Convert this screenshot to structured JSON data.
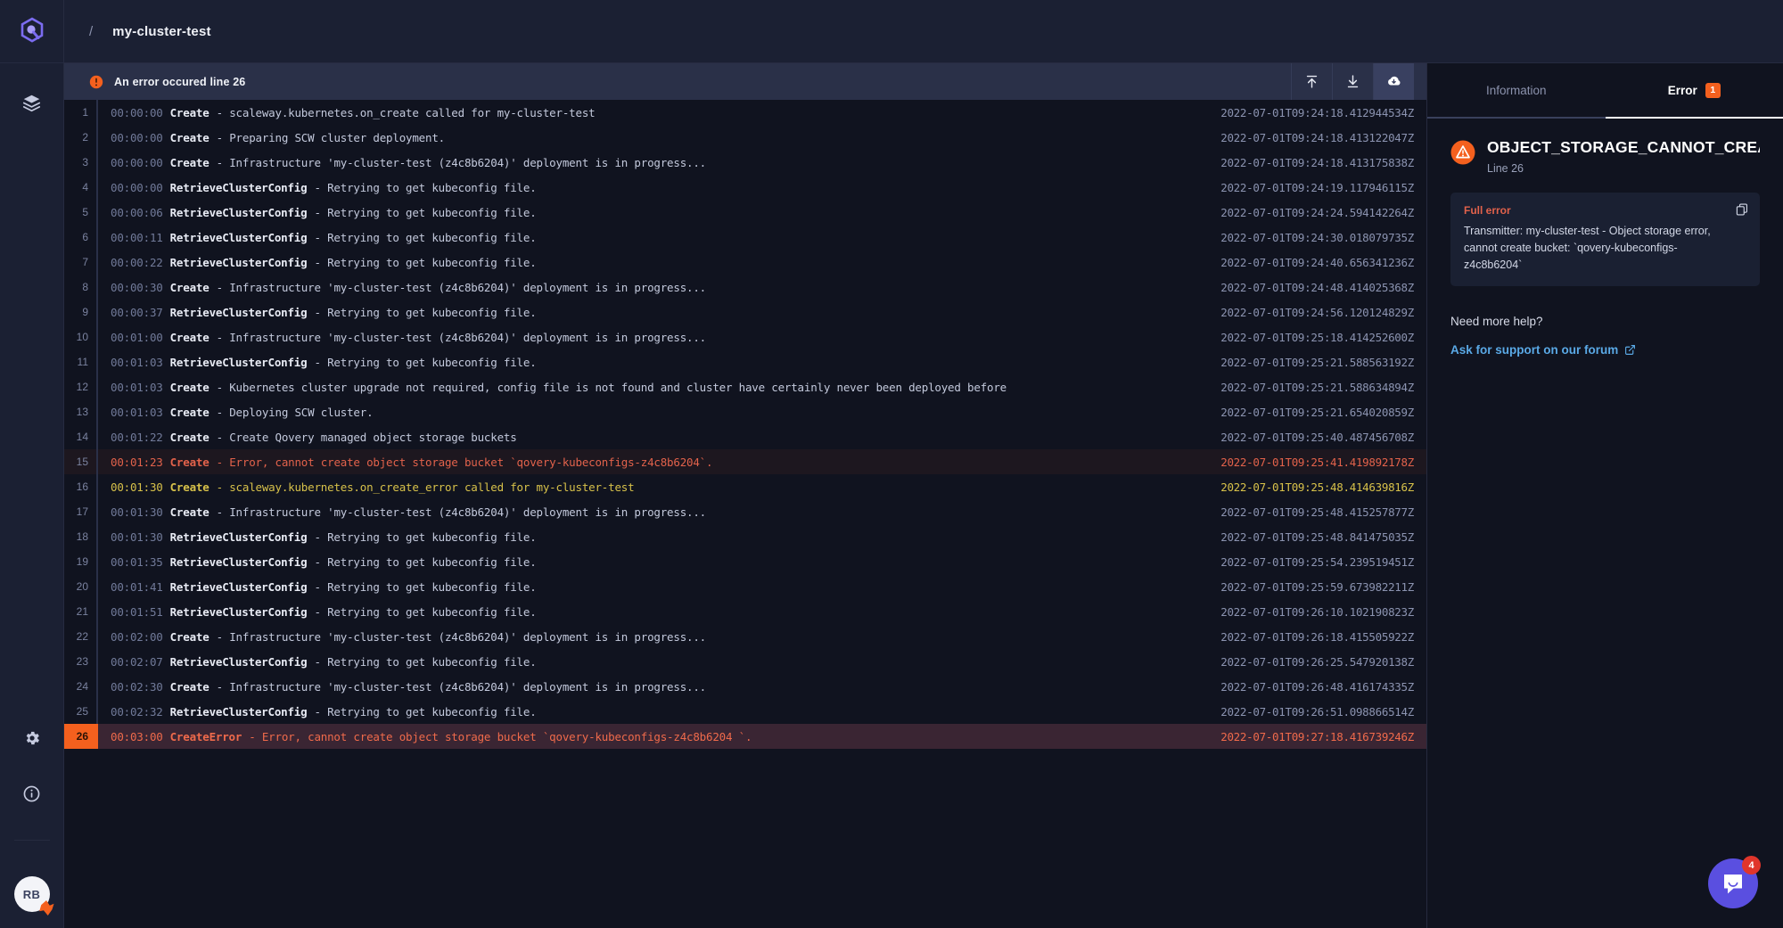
{
  "colors": {
    "accent_orange": "#f4601e",
    "error_red": "#e2624b",
    "warn_yellow": "#d7c14a",
    "link_blue": "#5aa9e6",
    "chat_purple": "#5a4fe0",
    "badge_red": "#e0352b",
    "panel_bg": "#10131f",
    "rail_bg": "#1b2033"
  },
  "rail": {
    "logo_icon": "qovery-hexagon-logo",
    "items": [
      {
        "icon": "layers-icon",
        "name": "sidebar-item-environments"
      }
    ],
    "bottom_items": [
      {
        "icon": "gear-icon",
        "name": "sidebar-item-settings"
      },
      {
        "icon": "info-icon",
        "name": "sidebar-item-info"
      }
    ],
    "avatar_initials": "RB"
  },
  "topbar": {
    "separator": "/",
    "cluster_name": "my-cluster-test"
  },
  "banner": {
    "icon": "error-circle-icon",
    "message": "An error occured line 26",
    "actions": [
      {
        "name": "scroll-to-top-button",
        "icon": "arrow-up-to-line-icon"
      },
      {
        "name": "download-logs-button",
        "icon": "arrow-down-to-line-icon"
      },
      {
        "name": "cloud-download-button",
        "icon": "cloud-download-icon"
      }
    ]
  },
  "logs": [
    {
      "n": "1",
      "time": "00:00:00",
      "step": "Create",
      "msg": "- scaleway.kubernetes.on_create called for my-cluster-test",
      "stamp": "2022-07-01T09:24:18.412944534Z",
      "level": "normal"
    },
    {
      "n": "2",
      "time": "00:00:00",
      "step": "Create",
      "msg": "- Preparing SCW cluster deployment.",
      "stamp": "2022-07-01T09:24:18.413122047Z",
      "level": "normal"
    },
    {
      "n": "3",
      "time": "00:00:00",
      "step": "Create",
      "msg": "- Infrastructure 'my-cluster-test (z4c8b6204)' deployment is in progress...",
      "stamp": "2022-07-01T09:24:18.413175838Z",
      "level": "normal"
    },
    {
      "n": "4",
      "time": "00:00:00",
      "step": "RetrieveClusterConfig",
      "msg": "- Retrying to get kubeconfig file.",
      "stamp": "2022-07-01T09:24:19.117946115Z",
      "level": "normal"
    },
    {
      "n": "5",
      "time": "00:00:06",
      "step": "RetrieveClusterConfig",
      "msg": "- Retrying to get kubeconfig file.",
      "stamp": "2022-07-01T09:24:24.594142264Z",
      "level": "normal"
    },
    {
      "n": "6",
      "time": "00:00:11",
      "step": "RetrieveClusterConfig",
      "msg": "- Retrying to get kubeconfig file.",
      "stamp": "2022-07-01T09:24:30.018079735Z",
      "level": "normal"
    },
    {
      "n": "7",
      "time": "00:00:22",
      "step": "RetrieveClusterConfig",
      "msg": "- Retrying to get kubeconfig file.",
      "stamp": "2022-07-01T09:24:40.656341236Z",
      "level": "normal"
    },
    {
      "n": "8",
      "time": "00:00:30",
      "step": "Create",
      "msg": "- Infrastructure 'my-cluster-test (z4c8b6204)' deployment is in progress...",
      "stamp": "2022-07-01T09:24:48.414025368Z",
      "level": "normal"
    },
    {
      "n": "9",
      "time": "00:00:37",
      "step": "RetrieveClusterConfig",
      "msg": "- Retrying to get kubeconfig file.",
      "stamp": "2022-07-01T09:24:56.120124829Z",
      "level": "normal"
    },
    {
      "n": "10",
      "time": "00:01:00",
      "step": "Create",
      "msg": "- Infrastructure 'my-cluster-test (z4c8b6204)' deployment is in progress...",
      "stamp": "2022-07-01T09:25:18.414252600Z",
      "level": "normal"
    },
    {
      "n": "11",
      "time": "00:01:03",
      "step": "RetrieveClusterConfig",
      "msg": "- Retrying to get kubeconfig file.",
      "stamp": "2022-07-01T09:25:21.588563192Z",
      "level": "normal"
    },
    {
      "n": "12",
      "time": "00:01:03",
      "step": "Create",
      "msg": "- Kubernetes cluster upgrade not required, config file is not found and cluster have certainly never been deployed before",
      "stamp": "2022-07-01T09:25:21.588634894Z",
      "level": "normal"
    },
    {
      "n": "13",
      "time": "00:01:03",
      "step": "Create",
      "msg": "- Deploying SCW cluster.",
      "stamp": "2022-07-01T09:25:21.654020859Z",
      "level": "normal"
    },
    {
      "n": "14",
      "time": "00:01:22",
      "step": "Create",
      "msg": "- Create Qovery managed object storage buckets",
      "stamp": "2022-07-01T09:25:40.487456708Z",
      "level": "normal"
    },
    {
      "n": "15",
      "time": "00:01:23",
      "step": "Create",
      "msg": "- Error, cannot create object storage bucket `qovery-kubeconfigs-z4c8b6204`.",
      "stamp": "2022-07-01T09:25:41.419892178Z",
      "level": "error"
    },
    {
      "n": "16",
      "time": "00:01:30",
      "step": "Create",
      "msg": "- scaleway.kubernetes.on_create_error called for my-cluster-test",
      "stamp": "2022-07-01T09:25:48.414639816Z",
      "level": "warn"
    },
    {
      "n": "17",
      "time": "00:01:30",
      "step": "Create",
      "msg": "- Infrastructure 'my-cluster-test (z4c8b6204)' deployment is in progress...",
      "stamp": "2022-07-01T09:25:48.415257877Z",
      "level": "normal"
    },
    {
      "n": "18",
      "time": "00:01:30",
      "step": "RetrieveClusterConfig",
      "msg": "- Retrying to get kubeconfig file.",
      "stamp": "2022-07-01T09:25:48.841475035Z",
      "level": "normal"
    },
    {
      "n": "19",
      "time": "00:01:35",
      "step": "RetrieveClusterConfig",
      "msg": "- Retrying to get kubeconfig file.",
      "stamp": "2022-07-01T09:25:54.239519451Z",
      "level": "normal"
    },
    {
      "n": "20",
      "time": "00:01:41",
      "step": "RetrieveClusterConfig",
      "msg": "- Retrying to get kubeconfig file.",
      "stamp": "2022-07-01T09:25:59.673982211Z",
      "level": "normal"
    },
    {
      "n": "21",
      "time": "00:01:51",
      "step": "RetrieveClusterConfig",
      "msg": "- Retrying to get kubeconfig file.",
      "stamp": "2022-07-01T09:26:10.102190823Z",
      "level": "normal"
    },
    {
      "n": "22",
      "time": "00:02:00",
      "step": "Create",
      "msg": "- Infrastructure 'my-cluster-test (z4c8b6204)' deployment is in progress...",
      "stamp": "2022-07-01T09:26:18.415505922Z",
      "level": "normal"
    },
    {
      "n": "23",
      "time": "00:02:07",
      "step": "RetrieveClusterConfig",
      "msg": "- Retrying to get kubeconfig file.",
      "stamp": "2022-07-01T09:26:25.547920138Z",
      "level": "normal"
    },
    {
      "n": "24",
      "time": "00:02:30",
      "step": "Create",
      "msg": "- Infrastructure 'my-cluster-test (z4c8b6204)' deployment is in progress...",
      "stamp": "2022-07-01T09:26:48.416174335Z",
      "level": "normal"
    },
    {
      "n": "25",
      "time": "00:02:32",
      "step": "RetrieveClusterConfig",
      "msg": "- Retrying to get kubeconfig file.",
      "stamp": "2022-07-01T09:26:51.098866514Z",
      "level": "normal"
    },
    {
      "n": "26",
      "time": "00:03:00",
      "step": "CreateError",
      "msg": "- Error, cannot create object storage bucket `qovery-kubeconfigs-z4c8b6204 `.",
      "stamp": "2022-07-01T09:27:18.416739246Z",
      "level": "fatal"
    }
  ],
  "panel": {
    "tabs": [
      {
        "label": "Information",
        "name": "tab-information",
        "active": false,
        "badge": ""
      },
      {
        "label": "Error",
        "name": "tab-error",
        "active": true,
        "badge": "1"
      }
    ],
    "error_title": "OBJECT_STORAGE_CANNOT_CREATE...",
    "error_line": "Line 26",
    "full_error_label": "Full error",
    "full_error_text": "Transmitter: my-cluster-test - Object storage error, cannot create bucket: `qovery-kubeconfigs-z4c8b6204`",
    "help_title": "Need more help?",
    "help_link": "Ask for support on our forum"
  },
  "chat": {
    "icon": "chat-bubble-icon",
    "unread": "4"
  }
}
